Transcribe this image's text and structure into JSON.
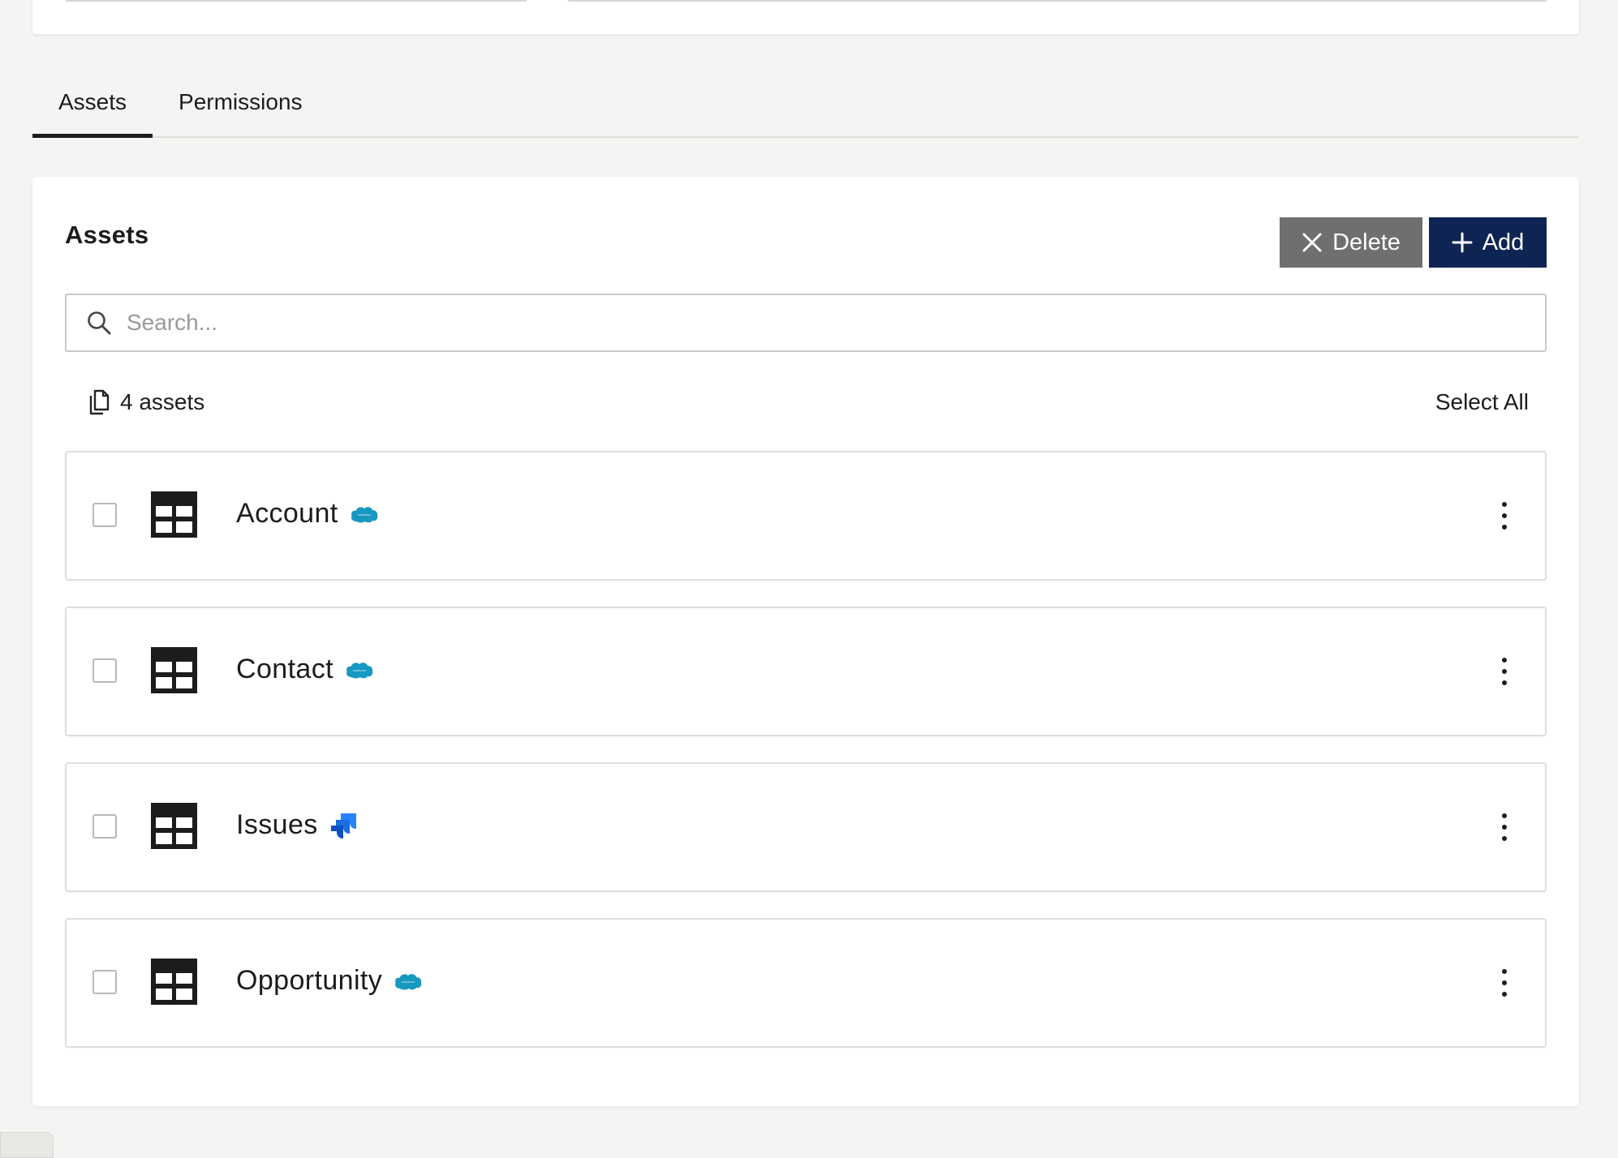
{
  "tabs": [
    {
      "label": "Assets",
      "active": true
    },
    {
      "label": "Permissions",
      "active": false
    }
  ],
  "card": {
    "title": "Assets",
    "delete_label": "Delete",
    "add_label": "Add",
    "search_placeholder": "Search...",
    "count_label": "4 assets",
    "select_all_label": "Select All"
  },
  "assets": [
    {
      "name": "Account",
      "source_icon": "salesforce-icon"
    },
    {
      "name": "Contact",
      "source_icon": "salesforce-icon"
    },
    {
      "name": "Issues",
      "source_icon": "jira-icon"
    },
    {
      "name": "Opportunity",
      "source_icon": "salesforce-icon"
    }
  ],
  "colors": {
    "add_button": "#0e2452",
    "delete_button": "#6f6f6f",
    "salesforce": "#1798c1",
    "jira": "#2684ff"
  }
}
